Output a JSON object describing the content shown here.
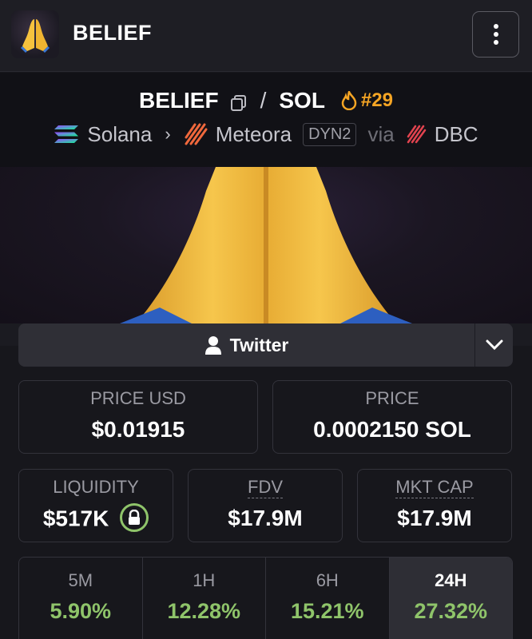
{
  "header": {
    "title": "BELIEF",
    "avatar_icon": "folded-hands-emoji",
    "menu_icon": "vertical-dots-icon"
  },
  "pair": {
    "base": "BELIEF",
    "separator": "/",
    "quote": "SOL",
    "rank": "#29",
    "rank_icon": "flame-icon"
  },
  "chain": {
    "network": "Solana",
    "dex": "Meteora",
    "pool_badge": "DYN2",
    "via": "via",
    "via_source": "DBC"
  },
  "banner": {
    "image": "folded-hands-banner"
  },
  "social": {
    "twitter_label": "Twitter"
  },
  "stats": {
    "price_usd_label": "PRICE USD",
    "price_usd_value": "$0.01915",
    "price_label": "PRICE",
    "price_value": "0.0002150 SOL",
    "liquidity_label": "LIQUIDITY",
    "liquidity_value": "$517K",
    "fdv_label": "FDV",
    "fdv_value": "$17.9M",
    "mktcap_label": "MKT CAP",
    "mktcap_value": "$17.9M"
  },
  "timeframes": [
    {
      "label": "5M",
      "value": "5.90%"
    },
    {
      "label": "1H",
      "value": "12.28%"
    },
    {
      "label": "6H",
      "value": "15.21%"
    },
    {
      "label": "24H",
      "value": "27.32%",
      "active": true
    }
  ],
  "colors": {
    "positive": "#8fc46a",
    "rank": "#f5a524",
    "background": "#17171c"
  }
}
